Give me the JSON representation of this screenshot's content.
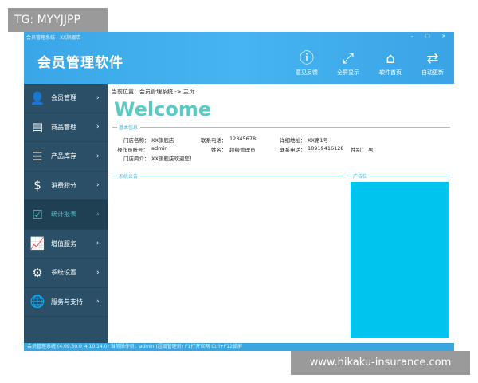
{
  "window": {
    "title": "会员管理系统 - XX旗舰店",
    "controls": "– □ ×"
  },
  "header": {
    "app_title": "会员管理软件",
    "buttons": [
      {
        "label": "意见反馈",
        "icon": "exclamation-icon"
      },
      {
        "label": "全屏显示",
        "icon": "fullscreen-icon"
      },
      {
        "label": "软件首页",
        "icon": "home-icon"
      },
      {
        "label": "自动更新",
        "icon": "refresh-icon"
      }
    ]
  },
  "sidebar": {
    "items": [
      {
        "label": "会员管理",
        "icon": "user-icon"
      },
      {
        "label": "商品管理",
        "icon": "document-icon"
      },
      {
        "label": "产品库存",
        "icon": "cabinet-icon"
      },
      {
        "label": "消费积分",
        "icon": "money-bag-icon"
      },
      {
        "label": "统计报表",
        "icon": "clipboard-icon",
        "active": true
      },
      {
        "label": "增值服务",
        "icon": "chart-icon"
      },
      {
        "label": "系统设置",
        "icon": "gear-icon"
      },
      {
        "label": "服务与支持",
        "icon": "globe-icon"
      }
    ],
    "chevron": "›"
  },
  "main": {
    "breadcrumb": "当前位置：会员管理系统 -> 主页",
    "welcome": "Welcome",
    "basic_title": "基本信息",
    "fields": {
      "store_name_label": "门店名称：",
      "store_name": "XX旗舰店",
      "phone_label": "联系电话：",
      "phone": "12345678",
      "address_label": "详细地址：",
      "address": "XX路1号",
      "operator_label": "操作员账号：",
      "operator": "admin",
      "name_label": "姓名：",
      "name": "超级管理员",
      "phone2_label": "联系电话：",
      "phone2": "18919416128",
      "gender_label": "性别：",
      "gender": "男",
      "intro_label": "门店简介：",
      "intro": "XX旗舰店欢迎您！"
    },
    "notice_title": "系统公告",
    "ad_title": "广告位",
    "ad_color": "#00c3ee"
  },
  "status": "会员管理系统 (4.09.30.0_4.10.14.0)  当前操作员：admin (超级管理员)  F1打开官网  Ctrl+F12锁屏",
  "watermarks": {
    "top": "TG: MYYJJPP",
    "bottom": "www.hikaku-insurance.com"
  }
}
